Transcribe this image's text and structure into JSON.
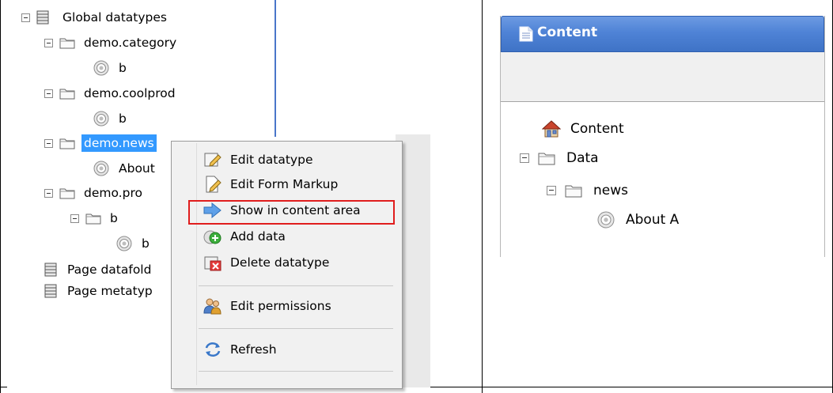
{
  "left_tree": {
    "global": "Global datatypes",
    "cat": "demo.category",
    "cat_child": "b",
    "cool": "demo.coolprod",
    "cool_child": "b",
    "news": "demo.news",
    "news_child": "About",
    "prod": "demo.pro",
    "prod_child": "b",
    "prod_grandchild": "b",
    "page_datafolder": "Page datafold",
    "page_metatype": "Page metatyp"
  },
  "context_menu": {
    "edit_datatype": "Edit datatype",
    "edit_form_markup": "Edit Form Markup",
    "show_in_content": "Show in content area",
    "add_data": "Add data",
    "delete_datatype": "Delete datatype",
    "edit_permissions": "Edit permissions",
    "refresh": "Refresh"
  },
  "right_panel": {
    "title": "Content",
    "root": "Content",
    "data": "Data",
    "news": "news",
    "about": "About A"
  },
  "colors": {
    "selection": "#3399ff",
    "header_blue": "#4f83d6",
    "highlight_red": "#e01d1d"
  }
}
